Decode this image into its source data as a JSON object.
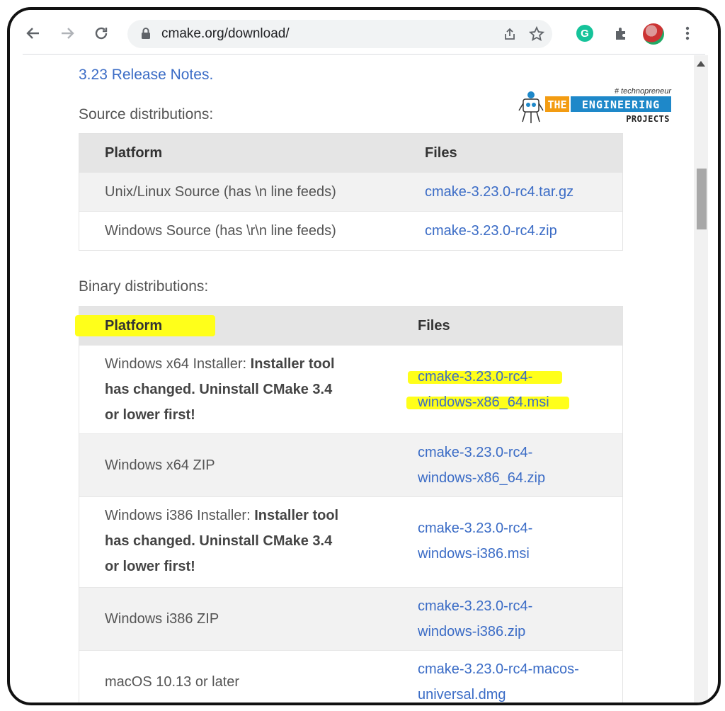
{
  "browser": {
    "url": "cmake.org/download/",
    "icons": [
      "back-arrow-icon",
      "forward-arrow-icon",
      "reload-icon",
      "lock-icon",
      "share-icon",
      "star-icon",
      "grammarly-icon",
      "extensions-icon",
      "profile-avatar",
      "menu-icon"
    ],
    "grammarly_letter": "G"
  },
  "page": {
    "release_notes_link": "3.23 Release Notes.",
    "source_label": "Source distributions:",
    "binary_label": "Binary distributions:",
    "source_table": {
      "headers": [
        "Platform",
        "Files"
      ],
      "rows": [
        {
          "platform": "Unix/Linux Source (has \\n line feeds)",
          "file": "cmake-3.23.0-rc4.tar.gz"
        },
        {
          "platform": "Windows Source (has \\r\\n line feeds)",
          "file": "cmake-3.23.0-rc4.zip"
        }
      ]
    },
    "binary_table": {
      "headers": [
        "Platform",
        "Files"
      ],
      "rows": [
        {
          "platform_lines": [
            "Windows x64 Installer: ",
            "Installer tool",
            "has changed. Uninstall CMake 3.4",
            "or lower first!"
          ],
          "file_lines": [
            "cmake-3.23.0-rc4-",
            "windows-x86_64.msi"
          ]
        },
        {
          "platform_lines": [
            "Windows x64 ZIP"
          ],
          "file_lines": [
            "cmake-3.23.0-rc4-",
            "windows-x86_64.zip"
          ]
        },
        {
          "platform_lines": [
            "Windows i386 Installer: ",
            "Installer tool",
            "has changed. Uninstall CMake 3.4",
            "or lower first!"
          ],
          "file_lines": [
            "cmake-3.23.0-rc4-",
            "windows-i386.msi"
          ]
        },
        {
          "platform_lines": [
            "Windows i386 ZIP"
          ],
          "file_lines": [
            "cmake-3.23.0-rc4-",
            "windows-i386.zip"
          ]
        },
        {
          "platform_lines": [
            "macOS 10.13 or later"
          ],
          "file_lines": [
            "cmake-3.23.0-rc4-macos-",
            "universal.dmg"
          ]
        }
      ]
    }
  },
  "watermark": {
    "tagline": "# technopreneur",
    "word1": "THE",
    "word2": "ENGINEERING",
    "word3": "PROJECTS",
    "colors": {
      "orange": "#f39c12",
      "blue": "#1e88c9"
    }
  },
  "colors": {
    "link": "#3b6cc6",
    "highlight": "#ffff1a",
    "header_bg": "#e5e5e5",
    "alt_bg": "#f2f2f2"
  }
}
